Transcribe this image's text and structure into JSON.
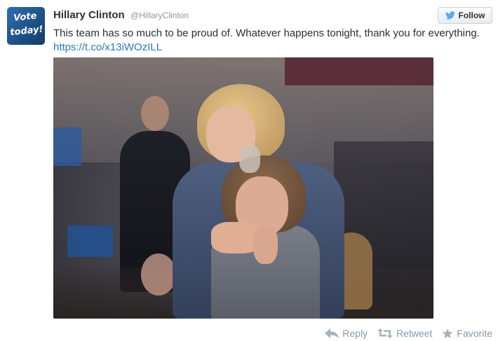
{
  "user": {
    "name": "Hillary Clinton",
    "handle": "@HillaryClinton",
    "avatar_text_line1": "Vote",
    "avatar_text_line2": "today!"
  },
  "follow_button": {
    "label": "Follow",
    "icon": "twitter-bird-icon"
  },
  "tweet": {
    "text": "This team has so much to be proud of. Whatever happens tonight, thank you for everything.",
    "link": "https://t.co/x13iWOzILL"
  },
  "actions": {
    "reply": {
      "label": "Reply",
      "icon": "reply-arrow-icon"
    },
    "retweet": {
      "label": "Retweet",
      "icon": "retweet-icon"
    },
    "favorite": {
      "label": "Favorite",
      "icon": "star-icon"
    }
  },
  "colors": {
    "link": "#2b7bb9",
    "muted": "#8899a6",
    "twitter_blue": "#55acee"
  }
}
